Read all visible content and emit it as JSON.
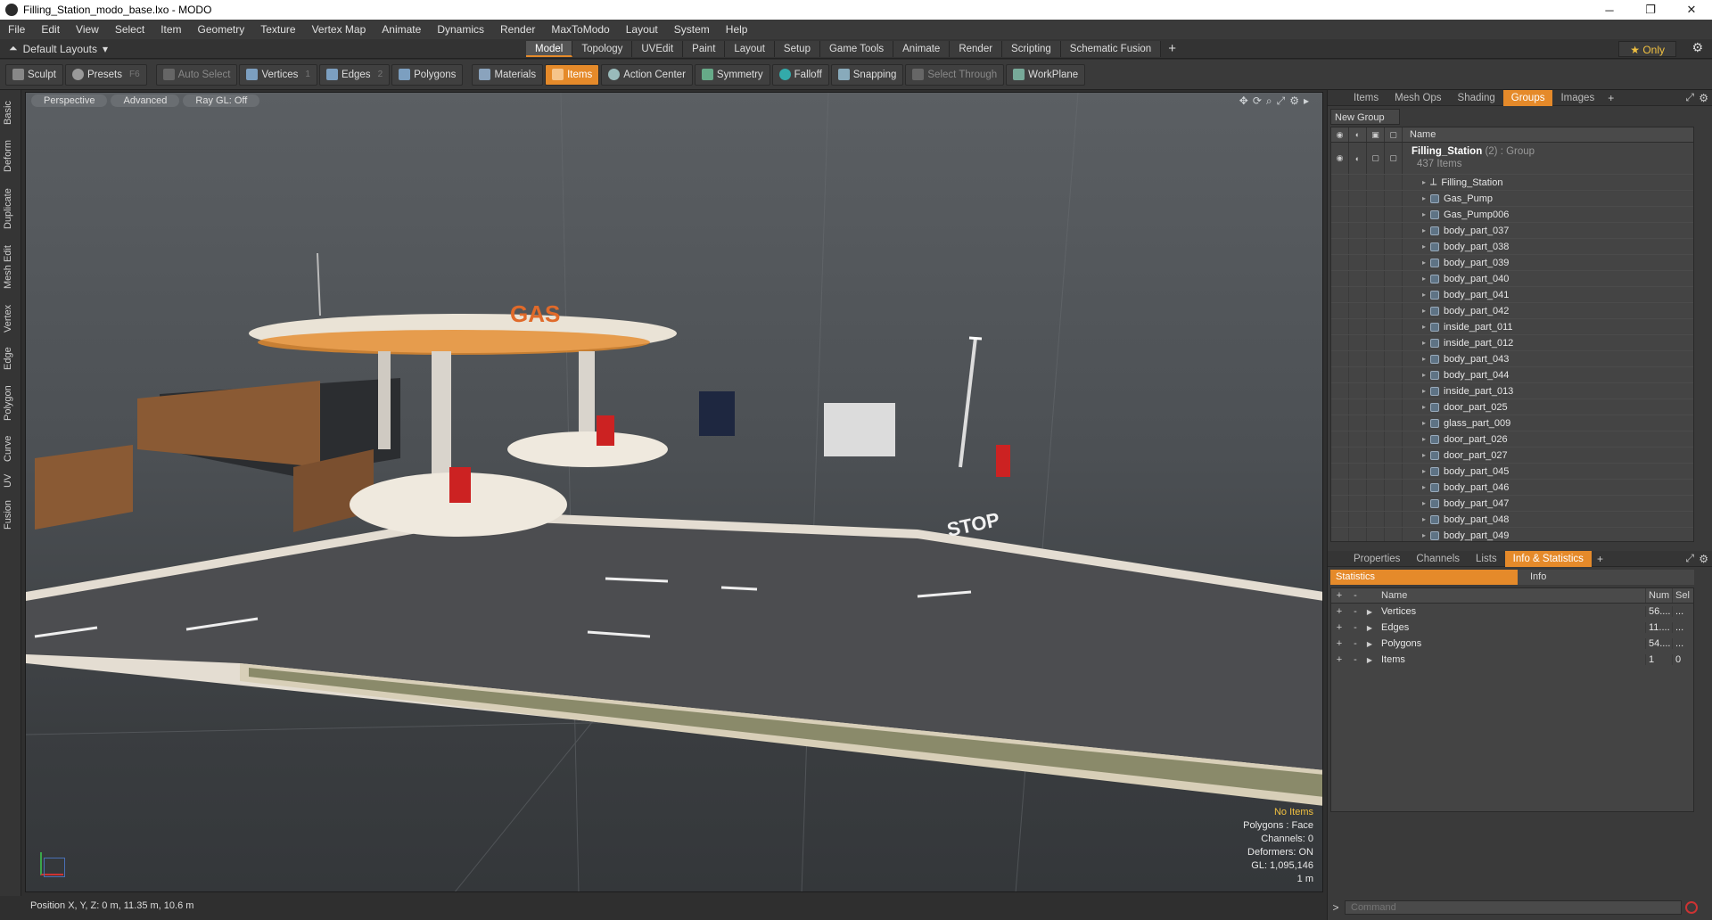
{
  "window": {
    "title": "Filling_Station_modo_base.lxo - MODO",
    "minimize": "─",
    "maximize": "❐",
    "close": "✕"
  },
  "menu": [
    "File",
    "Edit",
    "View",
    "Select",
    "Item",
    "Geometry",
    "Texture",
    "Vertex Map",
    "Animate",
    "Dynamics",
    "Render",
    "MaxToModo",
    "Layout",
    "System",
    "Help"
  ],
  "layoutbar": {
    "layout_name": "Default Layouts",
    "tabs": [
      "Model",
      "Topology",
      "UVEdit",
      "Paint",
      "Layout",
      "Setup",
      "Game Tools",
      "Animate",
      "Render",
      "Scripting",
      "Schematic Fusion"
    ],
    "active_tab": "Model",
    "only_label": "Only"
  },
  "toolbar": {
    "sculpt": "Sculpt",
    "presets": "Presets",
    "presets_key": "F6",
    "auto_select": "Auto Select",
    "vertices": "Vertices",
    "vertices_num": "1",
    "edges": "Edges",
    "edges_num": "2",
    "polygons": "Polygons",
    "materials": "Materials",
    "items": "Items",
    "action_center": "Action Center",
    "symmetry": "Symmetry",
    "falloff": "Falloff",
    "snapping": "Snapping",
    "select_through": "Select Through",
    "workplane": "WorkPlane"
  },
  "left_tabs": [
    "Basic",
    "Deform",
    "Duplicate",
    "Mesh Edit",
    "Vertex",
    "Edge",
    "Polygon",
    "Curve",
    "UV",
    "Fusion"
  ],
  "viewport": {
    "view_mode": "Perspective",
    "shading": "Advanced",
    "raygl": "Ray GL: Off",
    "info": {
      "selection": "No Items",
      "polygons": "Polygons : Face",
      "channels": "Channels: 0",
      "deformers": "Deformers: ON",
      "gl": "GL: 1,095,146",
      "scale": "1 m"
    },
    "sign_text": "GAS"
  },
  "status": {
    "position": "Position X, Y, Z:  0 m, 11.35 m, 10.6 m"
  },
  "top_panel": {
    "tabs": [
      "Items",
      "Mesh Ops",
      "Shading",
      "Groups",
      "Images"
    ],
    "active_tab": "Groups",
    "new_group": "New Group",
    "name_header": "Name",
    "group": {
      "name": "Filling_Station",
      "count_suffix": "(2) : Group",
      "items_count": "437 Items"
    },
    "children": [
      "Filling_Station",
      "Gas_Pump",
      "Gas_Pump006",
      "body_part_037",
      "body_part_038",
      "body_part_039",
      "body_part_040",
      "body_part_041",
      "body_part_042",
      "inside_part_011",
      "inside_part_012",
      "body_part_043",
      "body_part_044",
      "inside_part_013",
      "door_part_025",
      "glass_part_009",
      "door_part_026",
      "door_part_027",
      "body_part_045",
      "body_part_046",
      "body_part_047",
      "body_part_048",
      "body_part_049"
    ]
  },
  "bottom_panel": {
    "tabs": [
      "Properties",
      "Channels",
      "Lists",
      "Info & Statistics"
    ],
    "active_tab": "Info & Statistics",
    "sub_tabs": [
      "Statistics",
      "Info"
    ],
    "headers": {
      "name": "Name",
      "num": "Num",
      "sel": "Sel"
    },
    "rows": [
      {
        "name": "Vertices",
        "num": "56....",
        "sel": "..."
      },
      {
        "name": "Edges",
        "num": "11....",
        "sel": "..."
      },
      {
        "name": "Polygons",
        "num": "54....",
        "sel": "..."
      },
      {
        "name": "Items",
        "num": "1",
        "sel": "0"
      }
    ]
  },
  "command": {
    "placeholder": "Command"
  }
}
